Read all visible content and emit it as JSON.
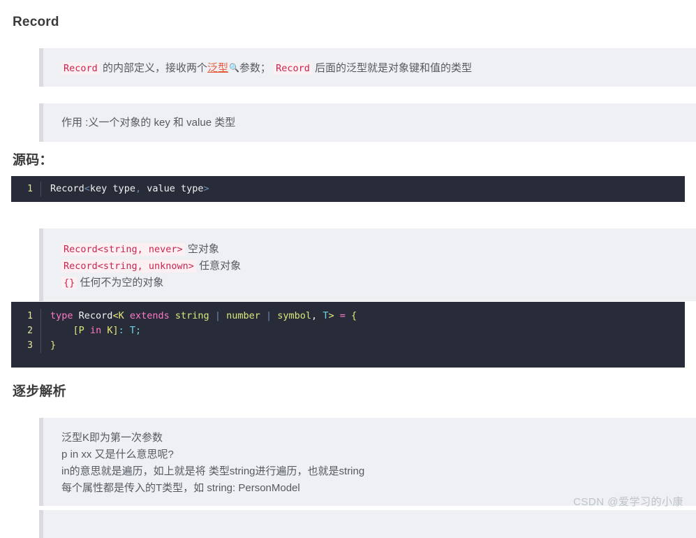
{
  "page": {
    "title": "Record",
    "watermark": "CSDN @爱学习的小康"
  },
  "headings": {
    "record": "Record",
    "source": "源码：",
    "steps": "逐步解析"
  },
  "quote_definition": {
    "code_1": "Record",
    "text_1": " 的内部定义，接收两个",
    "link": "泛型",
    "search_icon": "search-icon",
    "text_2": "参数；",
    "code_2": "Record",
    "text_3": " 后面的泛型就是对象键和值的类型"
  },
  "quote_usage": {
    "text": "作用 :义一个对象的 key 和 value 类型"
  },
  "quote_examples": {
    "lines": [
      {
        "code": "Record<string, never>",
        "text": " 空对象"
      },
      {
        "code": "Record<string, unknown>",
        "text": " 任意对象"
      },
      {
        "code": "{}",
        "text": " 任何不为空的对象"
      }
    ]
  },
  "quote_analysis": {
    "lines": [
      "泛型K即为第一次参数",
      "p in xx 又是什么意思呢?",
      "in的意思就是遍历，如上就是将 类型string进行遍历，也就是string",
      "每个属性都是传入的T类型，如 string: PersonModel"
    ]
  },
  "code_block_1": {
    "lines": [
      {
        "number": "1",
        "tokens": [
          {
            "t": "Record",
            "c": "t-white"
          },
          {
            "t": "<",
            "c": "t-punct"
          },
          {
            "t": "key type",
            "c": "t-white"
          },
          {
            "t": ",",
            "c": "t-punct"
          },
          {
            "t": " value type",
            "c": "t-white"
          },
          {
            "t": ">",
            "c": "t-punct"
          }
        ]
      }
    ]
  },
  "code_block_2": {
    "lines": [
      {
        "number": "1",
        "tokens": [
          {
            "t": "type",
            "c": "t-kw"
          },
          {
            "t": " ",
            "c": "t-plain"
          },
          {
            "t": "Record",
            "c": "t-white"
          },
          {
            "t": "<",
            "c": "t-brack"
          },
          {
            "t": "K",
            "c": "t-type"
          },
          {
            "t": " ",
            "c": "t-plain"
          },
          {
            "t": "extends",
            "c": "t-kw"
          },
          {
            "t": " ",
            "c": "t-plain"
          },
          {
            "t": "string",
            "c": "t-str"
          },
          {
            "t": " | ",
            "c": "t-pipe"
          },
          {
            "t": "number",
            "c": "t-str"
          },
          {
            "t": " | ",
            "c": "t-pipe"
          },
          {
            "t": "symbol",
            "c": "t-str"
          },
          {
            "t": ",",
            "c": "t-white"
          },
          {
            "t": " ",
            "c": "t-plain"
          },
          {
            "t": "T",
            "c": "t-cyan"
          },
          {
            "t": ">",
            "c": "t-brack"
          },
          {
            "t": " ",
            "c": "t-plain"
          },
          {
            "t": "=",
            "c": "t-kw"
          },
          {
            "t": " ",
            "c": "t-plain"
          },
          {
            "t": "{",
            "c": "t-brack"
          }
        ]
      },
      {
        "number": "2",
        "tokens": [
          {
            "t": "    ",
            "c": "t-plain"
          },
          {
            "t": "[",
            "c": "t-brack"
          },
          {
            "t": "P",
            "c": "t-str"
          },
          {
            "t": " ",
            "c": "t-plain"
          },
          {
            "t": "in",
            "c": "t-kw"
          },
          {
            "t": " ",
            "c": "t-plain"
          },
          {
            "t": "K",
            "c": "t-type"
          },
          {
            "t": "]",
            "c": "t-brack"
          },
          {
            "t": ":",
            "c": "t-cyan"
          },
          {
            "t": " ",
            "c": "t-plain"
          },
          {
            "t": "T",
            "c": "t-cyan"
          },
          {
            "t": ";",
            "c": "t-cyan"
          }
        ]
      },
      {
        "number": "3",
        "tokens": [
          {
            "t": "}",
            "c": "t-brack"
          }
        ]
      }
    ]
  },
  "colors": {
    "quote_bg": "#eef0f4",
    "quote_border": "#d9dbe0",
    "code_bg": "#282c39",
    "inline_code_text": "#c7254e",
    "inline_code_bg": "#fdf0f3",
    "link": "#e8593b",
    "heading": "#3b3b3b",
    "watermark": "#bfc3c9"
  }
}
